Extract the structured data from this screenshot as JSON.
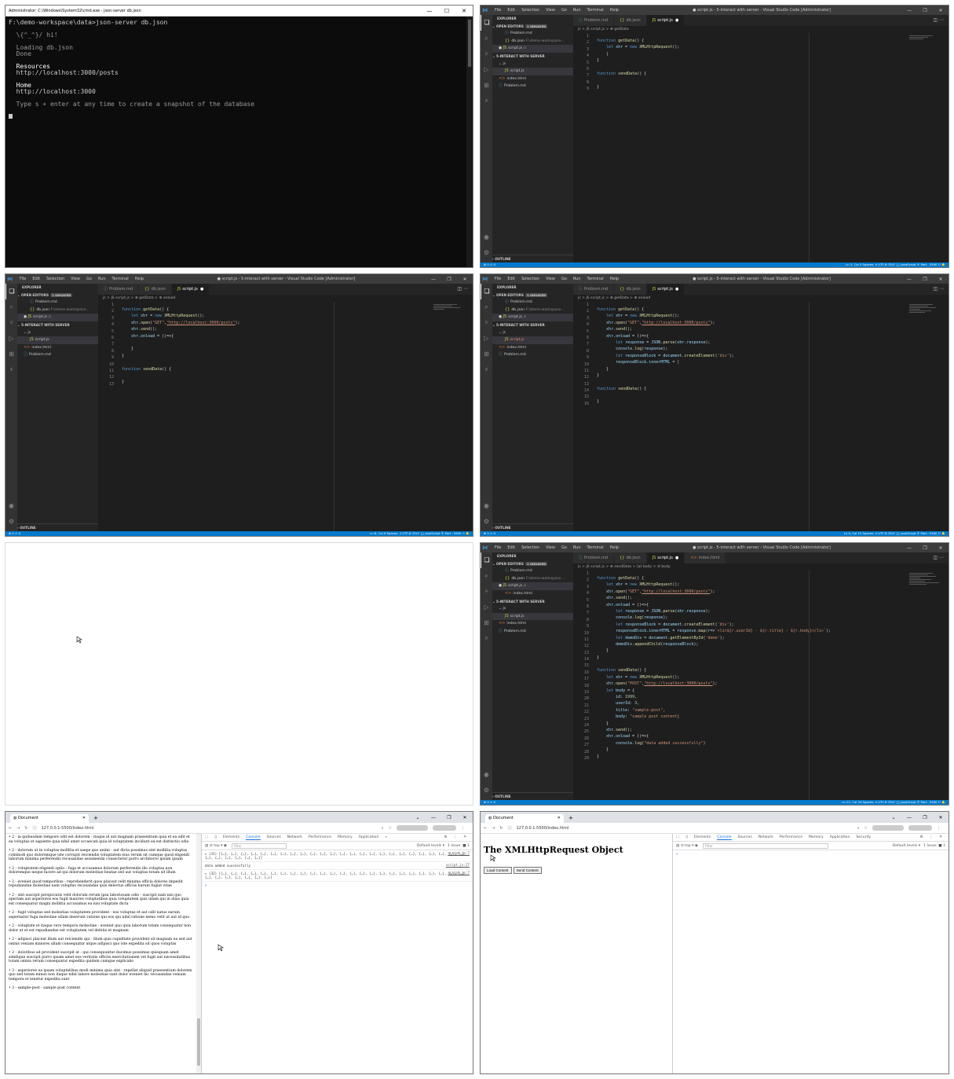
{
  "terminal": {
    "title": "Administrator: C:\\Windows\\System32\\cmd.exe - json-server db.json",
    "prompt": "F:\\demo-workspace\\data>json-server db.json",
    "hi": "  \\{^_^}/ hi!",
    "loading": "  Loading db.json",
    "done": "  Done",
    "res_head": "  Resources",
    "res_url": "  http://localhost:3000/posts",
    "home_head": "  Home",
    "home_url": "  http://localhost:3000",
    "snapshot": "  Type s + enter at any time to create a snapshot of the database"
  },
  "vscode": {
    "title": "● script.js - 5-interact with server - Visual Studio Code [Administrator]",
    "menu": [
      "File",
      "Edit",
      "Selection",
      "View",
      "Go",
      "Run",
      "Terminal",
      "Help"
    ],
    "explorer": "EXPLORER",
    "open_editors": "OPEN EDITORS",
    "unsaved": "1 UNSAVED",
    "oe_problem": "Problem.md",
    "oe_db": "db.json",
    "oe_db_path": "F:\\demo-workspace...",
    "oe_script": "script.js",
    "oe_script_path": "js",
    "oe_index": "index.html",
    "folder": "5-INTERACT WITH SERVER",
    "f_js": "js",
    "f_script": "script.js",
    "f_index": "index.html",
    "f_problem": "Problem.md",
    "outline": "OUTLINE",
    "tab_problem": "Problem.md",
    "tab_db": "db.json",
    "tab_script": "script.js",
    "tab_index": "index.html",
    "crumb1": "js > JS script.js > ⊕ getData",
    "crumb2": "js > JS script.js > ⊕ getData > ⊕ onload",
    "crumb3": "js > JS script.js > ⊕ getData > ⊕ onload",
    "crumb4": "js > JS script.js > ⊕ sendData > [ø] body > ⊘ body",
    "status_left": "⊗ 0 ⚠ 0",
    "status1": "Ln 3, Col 5   Spaces: 4   UTF-8   CRLF   {} JavaScript   ⦿ Port : 5500   ⚇  🔔",
    "status2": "Ln 6, Col 9   Spaces: 4   UTF-8   CRLF   {} JavaScript   ⦿ Port : 5500   ⚇  🔔",
    "status3": "Ln 9, Col 15   Spaces: 4   UTF-8   CRLF   {} JavaScript   ⦿ Port : 5500   ⚇  🔔",
    "status4": "Ln 22, Col 34   Spaces: 4   UTF-8   CRLF   {} JavaScript   ⦿ Port : 5500   ⚇  🔔"
  },
  "browser": {
    "tab_title": "Document",
    "url": "127.0.0.1:5500/index.html",
    "dev_tabs": [
      "Elements",
      "Console",
      "Sources",
      "Network",
      "Performance",
      "Memory",
      "Application",
      "»"
    ],
    "dev_tabs2": [
      "Elements",
      "Console",
      "Sources",
      "Network",
      "Performance",
      "Memory",
      "Application",
      "Security"
    ],
    "top": "top",
    "filter": "Filter",
    "default_levels": "Default levels ▾",
    "issues": "1 Issue: ■ 1",
    "msg1": "▸ (31) [{…}, {…}, {…}, {…}, {…}, {…}, {…}, {…}, {…}, {…}, {…}, {…}, {…}, {…}, {…}, {…}, {…}, {…}, {…}, {…}, {…}, {…}, {…}, {…}, {…}, {…}, {…}, {…}, {…}, {…}, {…}]",
    "msg1_src": "script.js:7",
    "msg2": "data added successfully",
    "msg2_src": "script.js:27",
    "msg3": "▸ (32) [{…}, {…}, {…}, {…}, {…}, {…}, {…}, {…}, {…}, {…}, {…}, {…}, {…}, {…}, {…}, {…}, {…}, {…}, {…}, {…}, {…}, {…}, {…}, {…}, {…}, {…}, {…}, {…}, {…}, {…}, {…}, {…}]",
    "msg3_src": "script.js:7",
    "prompt": ">",
    "posts": [
      "2 - ia quibusdam tempore odit est dolorem - itaque id aut magnam praesentium quia et ea odit et ea voluptas et sapiente quia nihil amet occaecati quia id voluptatem incidunt ea est distinctio odio",
      "2 - dolorum ut in voluptas mollitia et saepe quo animi - aut dicta possimus sint mollitia voluptas commodi quo doloremque iste corrupti reiciendis voluptatem eius rerum sit cumque quod eligendi laborum minima perferendis recusandae assumenda consectetur porro architecto ipsum ipsam",
      "2 - voluptatem eligendi optio - fuga et accusamus dolorum perferendis illo voluptas non doloremque neque facere ad qui dolorum molestiae beatae sed aut voluptas totam sit illum",
      "2 - eveniet quod temporibus - reprehenderit quos placeat velit minima officia dolores impedit repudiandae molestiae nam voluptas recusandae quis delectus officiis harum fugiat vitae",
      "2 - sint suscipit perspiciatis velit dolorum rerum ipsa laboriosam odio - suscipit nam nisi quo aperiam aut asperiores eos fugit maiores voluptatibus quia voluptatem quis ullam qui in alias quia est consequatur magni mollitia accusamus ea nisi voluptate dicta",
      "2 - fugit voluptas sed molestias voluptatem provident - eos voluptas et aut odit natus earum aspernatur fuga molestiae ullam deserunt ratione qui eos qui nihil ratione nemo velit ut aut id quo",
      "2 - voluptate et itaque vero tempora molestiae - eveniet quo quia laborum totam consequatur non dolor ut et est repudiandae est voluptatem vel debitis et magnam",
      "2 - adipisci placeat illum aut reiciendis qui - illum quis cupiditate provident sit magnam ea sed aut omnis veniam maiores ullam consequatur atque adipisci quo iste expedita sit quos voluptas",
      "2 - doloribus ad provident suscipit at - qui consequuntur ducimus possimus quisquam amet similique suscipit porro ipsam amet eos veritatis officiis exercitationem vel fugit aut necessitatibus totam omnis rerum consequatur expedita quidem cumque explicabo",
      "3 - asperiores ea ipsam voluptatibus modi minima quia sint - repellat aliquid praesentium dolorem quo sed totam minus non itaque nihil labore molestiae sunt dolor eveniet hic recusandae veniam tempora et tenetur expedita sunt",
      "3 - sample-post - sample post content"
    ],
    "heading": "The XMLHttpRequest Object",
    "load_btn": "Load Content",
    "send_btn": "Send Content"
  },
  "colors": {
    "vscode_bg": "#1e1e1e",
    "status_bar": "#007acc",
    "terminal_bg": "#0c0c0c",
    "accent": "#1a73e8"
  }
}
